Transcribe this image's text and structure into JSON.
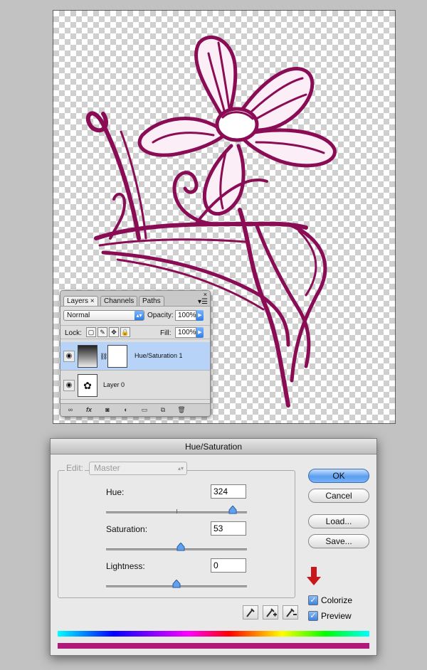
{
  "layers_panel": {
    "tabs": [
      "Layers",
      "Channels",
      "Paths"
    ],
    "tab_close_glyph": "×",
    "blend_mode": "Normal",
    "opacity_label": "Opacity:",
    "opacity_value": "100%",
    "lock_label": "Lock:",
    "fill_label": "Fill:",
    "fill_value": "100%",
    "layers": [
      {
        "name": "Hue/Saturation 1",
        "selected": true
      },
      {
        "name": "Layer 0",
        "selected": false
      }
    ]
  },
  "dialog": {
    "title": "Hue/Saturation",
    "edit_label": "Edit:",
    "edit_value": "Master",
    "hue_label": "Hue:",
    "hue_value": "324",
    "saturation_label": "Saturation:",
    "saturation_value": "53",
    "lightness_label": "Lightness:",
    "lightness_value": "0",
    "sliders": {
      "hue_fraction": 0.9,
      "saturation_fraction": 0.53,
      "lightness_fraction": 0.5
    },
    "buttons": {
      "ok": "OK",
      "cancel": "Cancel",
      "load": "Load...",
      "save": "Save..."
    },
    "colorize_label": "Colorize",
    "colorize_checked": true,
    "preview_label": "Preview",
    "preview_checked": true,
    "colors": {
      "colorized_bar": "#b0187a",
      "art_stroke": "#8a0c55",
      "arrow": "#c8181c"
    }
  },
  "icons": [
    "eye-icon",
    "chain-link-icon",
    "lock-icon",
    "brush-icon",
    "move-icon",
    "eyedropper-icon",
    "eyedropper-plus-icon",
    "eyedropper-minus-icon",
    "red-down-arrow-icon"
  ]
}
